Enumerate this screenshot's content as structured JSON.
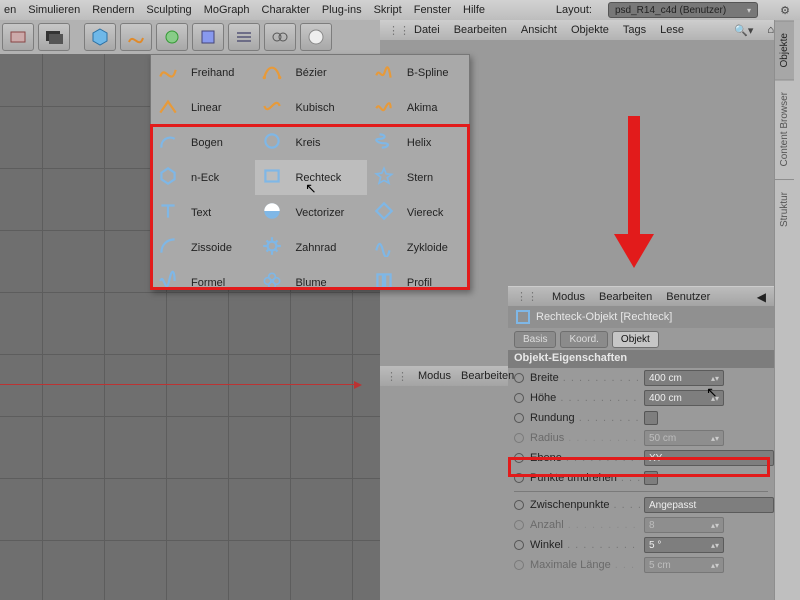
{
  "menubar": {
    "items": [
      "en",
      "Simulieren",
      "Rendern",
      "Sculpting",
      "MoGraph",
      "Charakter",
      "Plug-ins",
      "Skript",
      "Fenster",
      "Hilfe"
    ],
    "layout_label": "Layout:",
    "layout_value": "psd_R14_c4d (Benutzer)"
  },
  "panelmenu": {
    "items": [
      "Datei",
      "Bearbeiten",
      "Ansicht",
      "Objekte",
      "Tags",
      "Lese"
    ]
  },
  "sidetabs": {
    "tabs": [
      "Objekte",
      "Content Browser",
      "Struktur"
    ]
  },
  "popup": {
    "rows": [
      [
        {
          "icon": "freihand-icon",
          "label": "Freihand",
          "cls": "i-orange"
        },
        {
          "icon": "bezier-icon",
          "label": "Bézier",
          "cls": "i-orange"
        },
        {
          "icon": "bspline-icon",
          "label": "B-Spline",
          "cls": "i-orange"
        }
      ],
      [
        {
          "icon": "linear-icon",
          "label": "Linear",
          "cls": "i-orange"
        },
        {
          "icon": "kubisch-icon",
          "label": "Kubisch",
          "cls": "i-orange"
        },
        {
          "icon": "akima-icon",
          "label": "Akima",
          "cls": "i-orange"
        }
      ],
      [
        {
          "icon": "bogen-icon",
          "label": "Bogen",
          "cls": "i-blue"
        },
        {
          "icon": "kreis-icon",
          "label": "Kreis",
          "cls": "i-blue"
        },
        {
          "icon": "helix-icon",
          "label": "Helix",
          "cls": "i-blue"
        }
      ],
      [
        {
          "icon": "neck-icon",
          "label": "n-Eck",
          "cls": "i-blue"
        },
        {
          "icon": "rechteck-icon",
          "label": "Rechteck",
          "cls": "i-blue",
          "hover": true
        },
        {
          "icon": "stern-icon",
          "label": "Stern",
          "cls": "i-blue"
        }
      ],
      [
        {
          "icon": "text-icon",
          "label": "Text",
          "cls": "i-blue"
        },
        {
          "icon": "vectorizer-icon",
          "label": "Vectorizer",
          "cls": "i-blue"
        },
        {
          "icon": "viereck-icon",
          "label": "Viereck",
          "cls": "i-blue"
        }
      ],
      [
        {
          "icon": "zissoid-icon",
          "label": "Zissoide",
          "cls": "i-blue"
        },
        {
          "icon": "zahnrad-icon",
          "label": "Zahnrad",
          "cls": "i-blue"
        },
        {
          "icon": "zykloide-icon",
          "label": "Zykloide",
          "cls": "i-blue"
        }
      ],
      [
        {
          "icon": "formel-icon",
          "label": "Formel",
          "cls": "i-blue"
        },
        {
          "icon": "blume-icon",
          "label": "Blume",
          "cls": "i-blue"
        },
        {
          "icon": "profil-icon",
          "label": "Profil",
          "cls": "i-blue"
        }
      ]
    ]
  },
  "attr_head": {
    "items": [
      "Modus",
      "Bearbeiten",
      "Benutzer"
    ]
  },
  "mid_head": {
    "items": [
      "Modus",
      "Bearbeiten"
    ]
  },
  "object": {
    "title": "Rechteck-Objekt [Rechteck]"
  },
  "tabs": {
    "items": [
      "Basis",
      "Koord.",
      "Objekt"
    ],
    "active": 2
  },
  "section": {
    "title": "Objekt-Eigenschaften"
  },
  "props": {
    "breite": {
      "label": "Breite",
      "value": "400 cm"
    },
    "hoehe": {
      "label": "Höhe",
      "value": "400 cm"
    },
    "rundung": {
      "label": "Rundung"
    },
    "radius": {
      "label": "Radius",
      "value": "50 cm"
    },
    "ebene": {
      "label": "Ebene",
      "value": "XY"
    },
    "punkte": {
      "label": "Punkte umdrehen"
    },
    "zwischen": {
      "label": "Zwischenpunkte",
      "value": "Angepasst"
    },
    "anzahl": {
      "label": "Anzahl",
      "value": "8"
    },
    "winkel": {
      "label": "Winkel",
      "value": "5 °"
    },
    "maxl": {
      "label": "Maximale Länge",
      "value": "5 cm"
    }
  }
}
